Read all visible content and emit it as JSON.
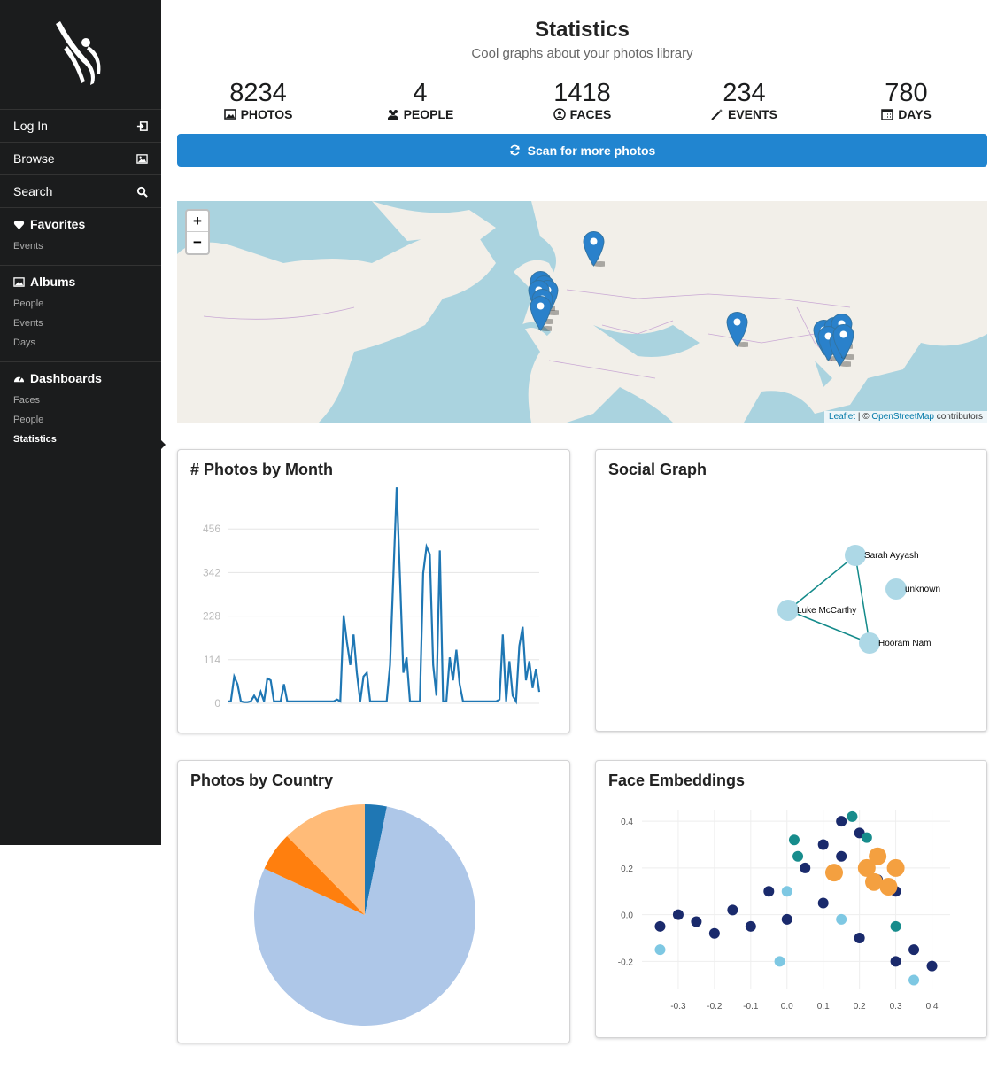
{
  "sidebar": {
    "items": [
      {
        "label": "Log In",
        "icon": "sign-in-icon"
      },
      {
        "label": "Browse",
        "icon": "image-icon"
      },
      {
        "label": "Search",
        "icon": "search-icon"
      }
    ],
    "favorites": {
      "label": "Favorites",
      "subs": [
        "Events"
      ]
    },
    "albums": {
      "label": "Albums",
      "subs": [
        "People",
        "Events",
        "Days"
      ]
    },
    "dashboards": {
      "label": "Dashboards",
      "subs": [
        "Faces",
        "People",
        "Statistics"
      ]
    }
  },
  "header": {
    "title": "Statistics",
    "subtitle": "Cool graphs about your photos library"
  },
  "stats": [
    {
      "value": "8234",
      "label": "PHOTOS",
      "icon": "image-icon"
    },
    {
      "value": "4",
      "label": "PEOPLE",
      "icon": "users-icon"
    },
    {
      "value": "1418",
      "label": "FACES",
      "icon": "user-circle-icon"
    },
    {
      "value": "234",
      "label": "EVENTS",
      "icon": "magic-wand-icon"
    },
    {
      "value": "780",
      "label": "DAYS",
      "icon": "calendar-icon"
    }
  ],
  "scan_button": "Scan for more photos",
  "map": {
    "zoom_in": "+",
    "zoom_out": "−",
    "attribution_leaflet": "Leaflet",
    "attribution_sep": " | © ",
    "attribution_osm": "OpenStreetMap",
    "attribution_tail": " contributors"
  },
  "cards": {
    "photos_by_month": "# Photos by Month",
    "social_graph": "Social Graph",
    "photos_by_country": "Photos by Country",
    "face_embeddings": "Face Embeddings"
  },
  "colors": {
    "accent": "#2185d0",
    "sidebar": "#1b1c1d",
    "line": "#1f77b4"
  },
  "chart_data": [
    {
      "type": "line",
      "title": "# Photos by Month",
      "yticks": [
        0,
        114,
        228,
        342,
        456
      ],
      "ylim": [
        0,
        570
      ],
      "series": [
        {
          "values": [
            5,
            5,
            70,
            50,
            5,
            3,
            3,
            5,
            20,
            5,
            30,
            5,
            65,
            60,
            5,
            5,
            5,
            50,
            5,
            5,
            5,
            5,
            5,
            5,
            5,
            5,
            5,
            5,
            5,
            5,
            5,
            5,
            5,
            10,
            5,
            230,
            160,
            100,
            180,
            80,
            5,
            70,
            80,
            5,
            5,
            5,
            5,
            5,
            5,
            100,
            330,
            565,
            330,
            80,
            120,
            5,
            5,
            5,
            5,
            340,
            410,
            390,
            100,
            20,
            400,
            5,
            5,
            120,
            60,
            140,
            50,
            5,
            5,
            5,
            5,
            5,
            5,
            5,
            5,
            5,
            5,
            5,
            10,
            180,
            5,
            110,
            20,
            5,
            150,
            200,
            60,
            110,
            40,
            90,
            30
          ]
        }
      ],
      "grid": true
    },
    {
      "type": "graph",
      "title": "Social Graph",
      "nodes": [
        "Sarah Ayyash",
        "unknown",
        "Luke McCarthy",
        "Hooram Nam"
      ],
      "edges": [
        [
          "Sarah Ayyash",
          "Luke McCarthy"
        ],
        [
          "Sarah Ayyash",
          "Hooram Nam"
        ],
        [
          "Luke McCarthy",
          "Hooram Nam"
        ]
      ]
    },
    {
      "type": "pie",
      "title": "Photos by Country",
      "values": [
        3.2,
        78.7,
        5.7,
        12.4
      ],
      "colors": [
        "#1f77b4",
        "#aec7e8",
        "#ff7f0e",
        "#ffbb78"
      ]
    },
    {
      "type": "scatter",
      "title": "Face Embeddings",
      "xticks": [
        -0.3,
        -0.2,
        -0.1,
        0.0,
        0.1,
        0.2,
        0.3,
        0.4
      ],
      "yticks": [
        0.4,
        0.2,
        0.0,
        -0.2
      ],
      "xlim": [
        -0.4,
        0.45
      ],
      "ylim": [
        -0.32,
        0.45
      ],
      "series": [
        {
          "color": "#1a2a6c",
          "points": [
            [
              -0.35,
              -0.05
            ],
            [
              -0.3,
              0.0
            ],
            [
              -0.25,
              -0.03
            ],
            [
              -0.2,
              -0.08
            ],
            [
              -0.15,
              0.02
            ],
            [
              -0.1,
              -0.05
            ],
            [
              0.05,
              0.2
            ],
            [
              0.1,
              0.3
            ],
            [
              0.15,
              0.25
            ],
            [
              0.2,
              0.35
            ],
            [
              0.25,
              0.15
            ],
            [
              0.3,
              -0.2
            ],
            [
              0.35,
              -0.15
            ],
            [
              0.4,
              -0.22
            ],
            [
              0.1,
              0.05
            ],
            [
              0.2,
              -0.1
            ],
            [
              -0.05,
              0.1
            ],
            [
              0.0,
              -0.02
            ],
            [
              0.3,
              0.1
            ],
            [
              0.15,
              0.4
            ]
          ]
        },
        {
          "color": "#178c8c",
          "points": [
            [
              0.02,
              0.32
            ],
            [
              0.18,
              0.42
            ],
            [
              0.3,
              -0.05
            ],
            [
              0.22,
              0.33
            ],
            [
              0.03,
              0.25
            ]
          ]
        },
        {
          "color": "#7ec8e3",
          "points": [
            [
              -0.35,
              -0.15
            ],
            [
              -0.02,
              -0.2
            ],
            [
              0.15,
              -0.02
            ],
            [
              0.35,
              -0.28
            ],
            [
              0.0,
              0.1
            ]
          ]
        },
        {
          "color": "#f4a040",
          "points": [
            [
              0.13,
              0.18
            ],
            [
              0.22,
              0.2
            ],
            [
              0.25,
              0.25
            ],
            [
              0.3,
              0.2
            ],
            [
              0.28,
              0.12
            ],
            [
              0.24,
              0.14
            ]
          ]
        }
      ]
    }
  ]
}
